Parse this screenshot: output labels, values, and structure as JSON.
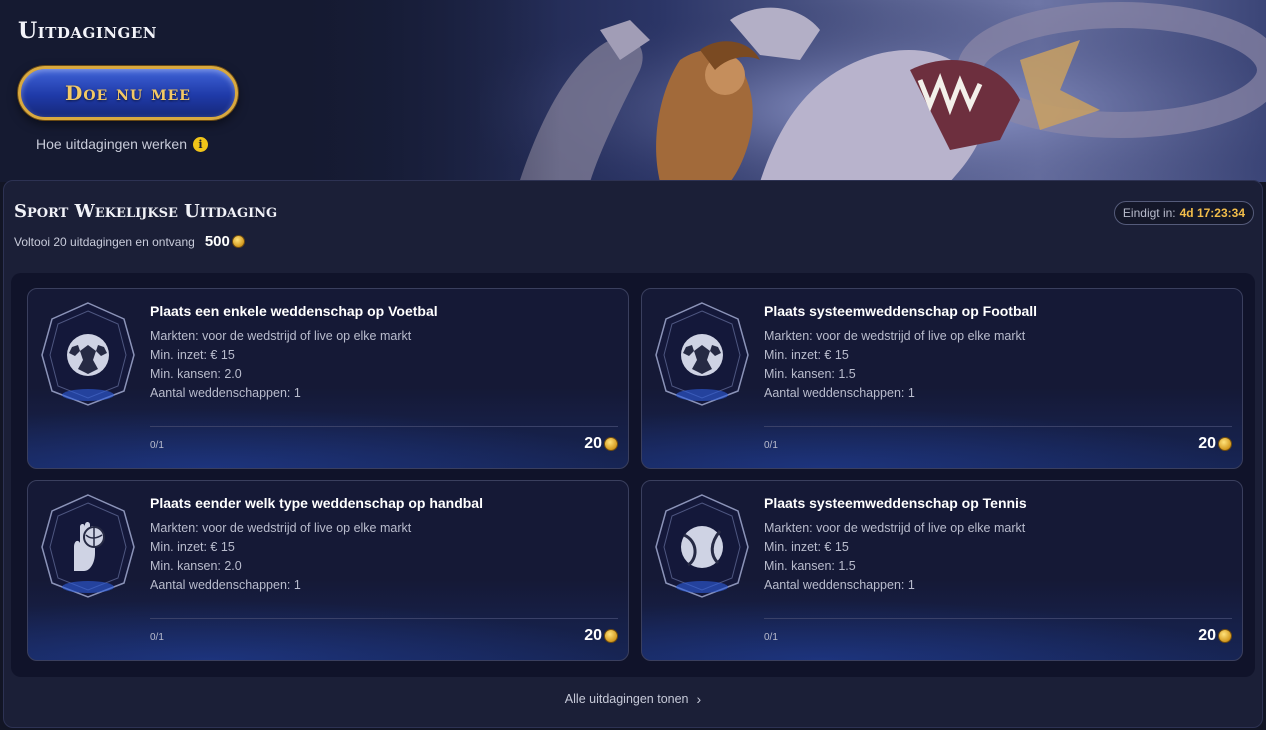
{
  "hero": {
    "title": "Uitdagingen",
    "join_label": "Doe nu mee",
    "how_label": "Hoe uitdagingen werken",
    "info_icon": "i"
  },
  "challenge": {
    "title": "Sport Wekelijkse Uitdaging",
    "subtitle": "Voltooi 20 uitdagingen en ontvang",
    "reward_total": "500",
    "timer_label": "Eindigt in:",
    "timer_value": "4d 17:23:34"
  },
  "cards": [
    {
      "icon": "soccer-ball-icon",
      "title": "Plaats een enkele weddenschap op Voetbal",
      "markets": "Markten: voor de wedstrijd of live op elke markt",
      "min_stake": "Min. inzet: € 15",
      "min_odds": "Min. kansen: 2.0",
      "bet_count": "Aantal weddenschappen: 1",
      "progress": "0/1",
      "reward": "20"
    },
    {
      "icon": "soccer-ball-icon",
      "title": "Plaats systeemweddenschap op Football",
      "markets": "Markten: voor de wedstrijd of live op elke markt",
      "min_stake": "Min. inzet: € 15",
      "min_odds": "Min. kansen: 1.5",
      "bet_count": "Aantal weddenschappen: 1",
      "progress": "0/1",
      "reward": "20"
    },
    {
      "icon": "handball-icon",
      "title": "Plaats eender welk type weddenschap op handbal",
      "markets": "Markten: voor de wedstrijd of live op elke markt",
      "min_stake": "Min. inzet: € 15",
      "min_odds": "Min. kansen: 2.0",
      "bet_count": "Aantal weddenschappen: 1",
      "progress": "0/1",
      "reward": "20"
    },
    {
      "icon": "tennis-ball-icon",
      "title": "Plaats systeemweddenschap op Tennis",
      "markets": "Markten: voor de wedstrijd of live op elke markt",
      "min_stake": "Min. inzet: € 15",
      "min_odds": "Min. kansen: 1.5",
      "bet_count": "Aantal weddenschappen: 1",
      "progress": "0/1",
      "reward": "20"
    }
  ],
  "footer": {
    "show_all_label": "Alle uitdagingen tonen"
  },
  "colors": {
    "accent_gold": "#f2bd4a",
    "button_blue": "#1f3aa8",
    "panel_bg": "#1b1f37"
  }
}
